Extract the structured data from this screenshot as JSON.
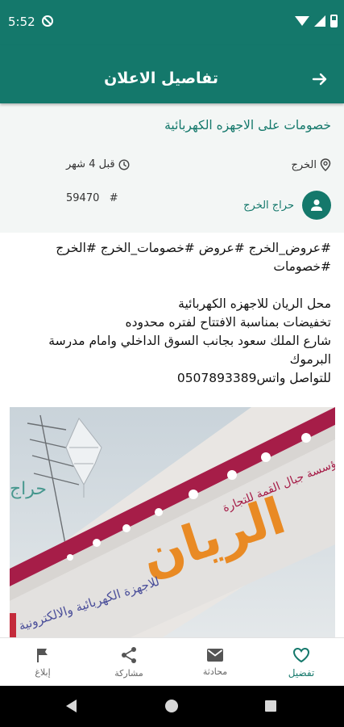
{
  "status_bar": {
    "time": "5:52"
  },
  "app_bar": {
    "title": "تفاصيل الاعلان"
  },
  "ad": {
    "title": "خصومات على الاجهزه الكهربائية",
    "location": "الخرج",
    "posted_time": "قبل 4 شهر",
    "number": "59470",
    "author": "حراج الخرج",
    "description_lines": [
      "#عروض_الخرج #عروض #خصومات_الخرج #الخرج",
      "#خصومات",
      "",
      "محل الريان للاجهزه الكهربائية",
      "تخفيضات بمناسبة الافتتاح لفتره محدوده",
      "شارع الملك سعود بجانب السوق الداخلي وامام مدرسة",
      "البرموك",
      "للتواصل واتس0507893389"
    ]
  },
  "image": {
    "watermark": "حراج الخرج",
    "store_name": "الريان",
    "store_subtitle": "للاجهزة الكهربائية والالكترونية",
    "neighbor_sign": "مؤسسة جبال القمة للتجارة"
  },
  "bottom_nav": {
    "favorite": "تفضيل",
    "chat": "محادثة",
    "share": "مشاركة",
    "report": "إبلاغ"
  },
  "colors": {
    "primary": "#14786b",
    "accent_orange": "#e98a24"
  },
  "icons": [
    "arrow-forward-icon",
    "location-pin-icon",
    "clock-icon",
    "person-icon",
    "heart-icon",
    "mail-icon",
    "share-icon",
    "flag-icon"
  ]
}
